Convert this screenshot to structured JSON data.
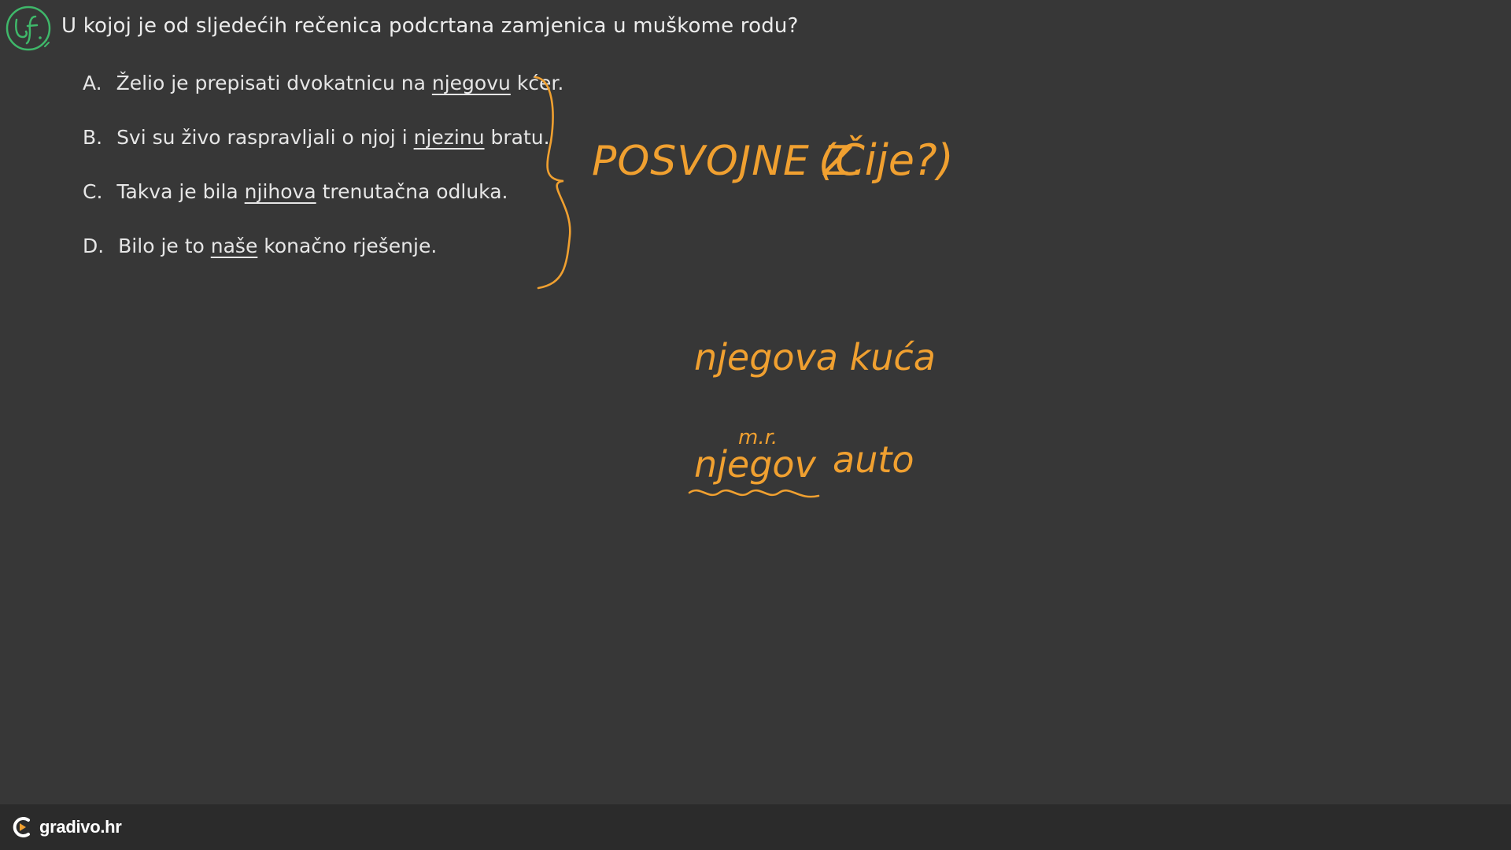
{
  "badge": {
    "label": "Lf."
  },
  "question": "U kojoj je od sljedećih rečenica podcrtana zamjenica u muškome rodu?",
  "answers": [
    {
      "letter": "A.",
      "before": "Želio je prepisati dvokatnicu na",
      "underlined": "njegovu",
      "after": "kćer."
    },
    {
      "letter": "B.",
      "before": "Svi su živo raspravljali o njoj i",
      "underlined": "njezinu",
      "after": "bratu."
    },
    {
      "letter": "C.",
      "before": "Takva je bila",
      "underlined": "njihova",
      "after": "trenutačna odluka."
    },
    {
      "letter": "D.",
      "before": "Bilo je to",
      "underlined": "naše",
      "after": "konačno rješenje."
    }
  ],
  "handwriting": {
    "group_label": "POSVOJNE Z.",
    "group_question": "(Čije?)",
    "example1": "njegova kuća",
    "gender_note": "m.r.",
    "example2_pronoun": "njegov",
    "example2_noun": "auto"
  },
  "footer": {
    "brand": "gradivo.hr"
  },
  "colors": {
    "background": "#373737",
    "footer": "#2b2b2b",
    "ink_orange": "#f0a030",
    "badge_green": "#3fb86a",
    "text": "#e8e8e8"
  }
}
